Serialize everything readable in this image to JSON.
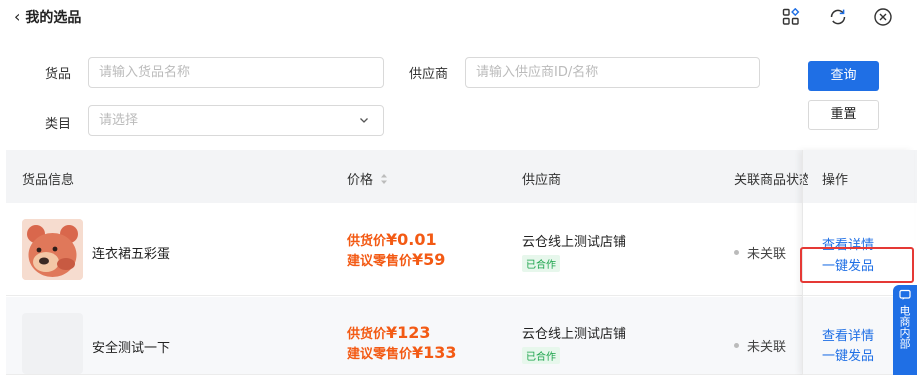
{
  "header": {
    "title": "我的选品",
    "icons": [
      "grid-diamond-icon",
      "refresh-icon",
      "close-circle-icon"
    ]
  },
  "filters": {
    "goods_label": "货品",
    "goods_placeholder": "请输入货品名称",
    "supplier_label": "供应商",
    "supplier_placeholder": "请输入供应商ID/名称",
    "category_label": "类目",
    "category_placeholder": "请选择",
    "search_button": "查询",
    "reset_button": "重置"
  },
  "table": {
    "columns": [
      "货品信息",
      "价格",
      "供应商",
      "关联商品状态",
      "操作"
    ],
    "rows": [
      {
        "name": "连衣裙五彩蛋",
        "supply_label": "供货价",
        "supply_price": "¥0.01",
        "retail_label": "建议零售价",
        "retail_price": "¥59",
        "supplier": "云仓线上测试店铺",
        "tag": "已合作",
        "status": "未关联",
        "action_detail": "查看详情",
        "action_publish": "一键发品"
      },
      {
        "name": "安全测试一下",
        "supply_label": "供货价",
        "supply_price": "¥123",
        "retail_label": "建议零售价",
        "retail_price": "¥133",
        "supplier": "云仓线上测试店铺",
        "tag": "已合作",
        "status": "未关联",
        "action_detail": "查看详情",
        "action_publish": "一键发品"
      }
    ]
  },
  "side_widget": {
    "text": "电商内部"
  },
  "colors": {
    "primary": "#1f6fe5",
    "price": "#f35a14",
    "tag_green": "#1aa34a",
    "highlight_red": "#e53935"
  }
}
